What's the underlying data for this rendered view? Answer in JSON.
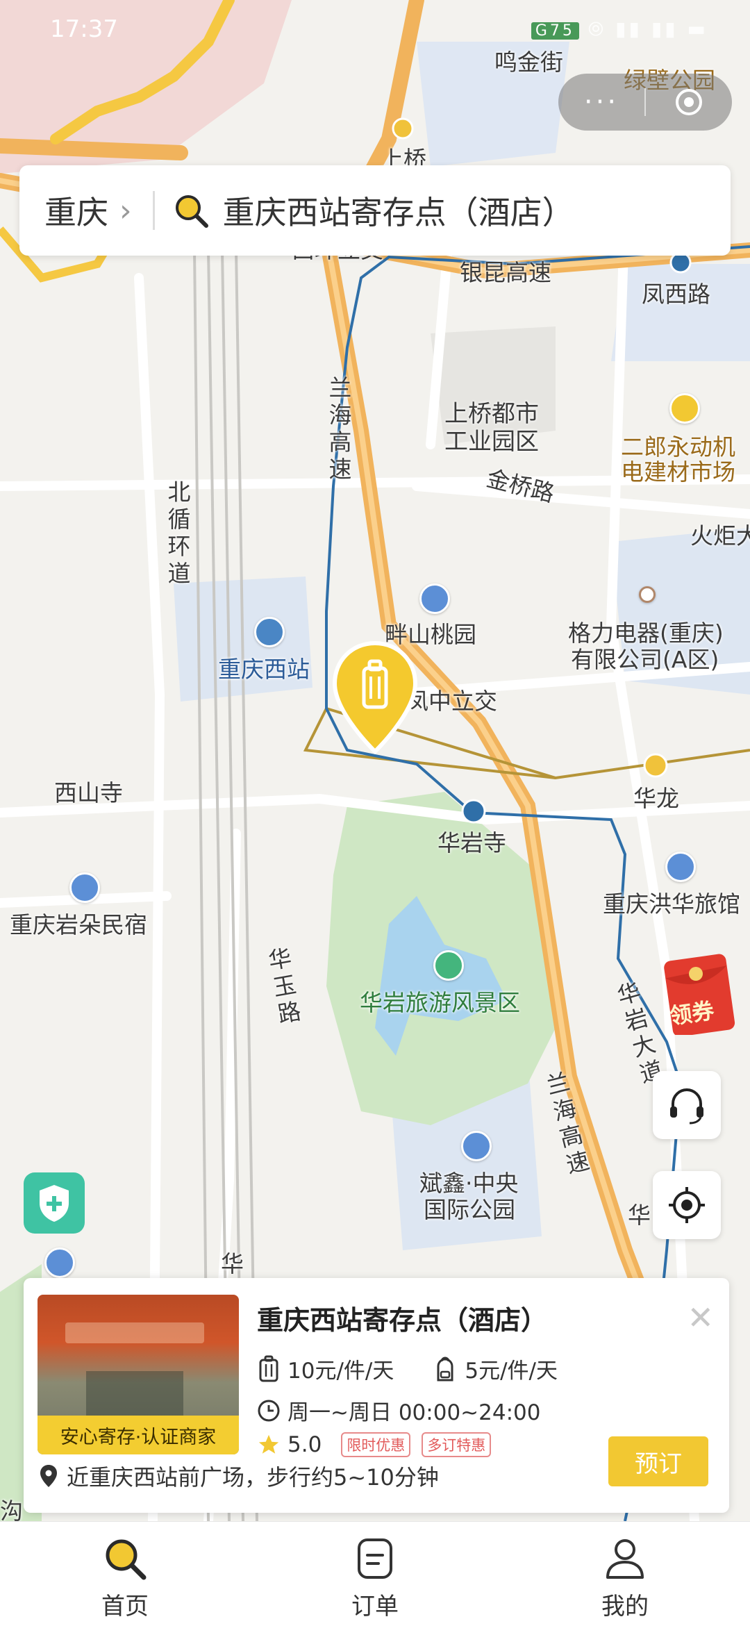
{
  "status_bar": {
    "time": "17:37",
    "network": "G75"
  },
  "capsule": {
    "more_label": "···"
  },
  "search_bar": {
    "city": "重庆",
    "query": "重庆西站寄存点（酒店）"
  },
  "map": {
    "labels": {
      "mingjin_street": "鸣金街",
      "lvbi_park": "绿壁公园",
      "shangqiao": "上桥",
      "xihuanlijiao": "西环立交",
      "yinkun_expressway": "银昆高速",
      "fengxi_road": "凤西路",
      "shangqiao_industrial_1": "上桥都市",
      "shangqiao_industrial_2": "工业园区",
      "erlang_market_1": "二郎永动机",
      "erlang_market_2": "电建材市场",
      "jinqiao_road": "金桥路",
      "huoju": "火炬大",
      "lanhai_expressway_v": "兰海高速",
      "beixun_ring_v": "北循环道",
      "panshan_taoyuan": "畔山桃园",
      "gree_1": "格力电器(重庆)",
      "gree_2": "有限公司(A区)",
      "chongqing_west_station": "重庆西站",
      "fengzhong_interchange": "凤中立交",
      "xishan_temple": "西山寺",
      "hualong": "华龙",
      "huayan_temple": "华岩寺",
      "huayu_road_v": "华玉路",
      "chongqing_yanduo": "重庆岩朵民宿",
      "chongqing_honghua": "重庆洪华旅馆",
      "huayan_scenic": "华岩旅游风景区",
      "huayan_avenue_v": "华岩大道",
      "lanhai_expressway2": "兰海高速",
      "binxin_1": "斌鑫·中央",
      "binxin_2": "国际公园",
      "hua_bottom": "华",
      "hua_left": "华",
      "gou": "沟"
    }
  },
  "red_packet": {
    "label": "领券"
  },
  "store_card": {
    "name": "重庆西站寄存点（酒店）",
    "thumb_tag": "安心寄存·认证商家",
    "price_luggage": "10元/件/天",
    "price_bag": "5元/件/天",
    "hours": "周一~周日 00:00~24:00",
    "rating": "5.0",
    "badge_1": "限时优惠",
    "badge_2": "多订特惠",
    "address": "近重庆西站前广场，步行约5~10分钟",
    "book_label": "预订"
  },
  "tabs": [
    {
      "label": "首页"
    },
    {
      "label": "订单"
    },
    {
      "label": "我的"
    }
  ],
  "colors": {
    "accent": "#f2c832",
    "road_orange": "#f1b35c",
    "metro_blue": "#2f6fa8",
    "park_green": "#cfe7c4"
  }
}
